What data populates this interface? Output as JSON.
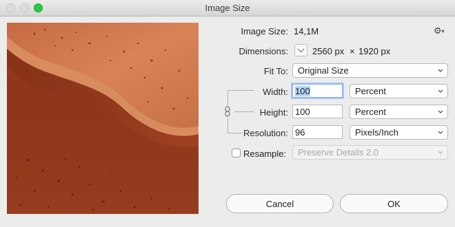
{
  "window": {
    "title": "Image Size"
  },
  "preview": {
    "alt": "Orange desert dunes aerial photo"
  },
  "image_size": {
    "label": "Image Size:",
    "value": "14,1M"
  },
  "dimensions": {
    "label": "Dimensions:",
    "width": "2560 px",
    "times": "×",
    "height": "1920 px"
  },
  "fit_to": {
    "label": "Fit To:",
    "value": "Original Size"
  },
  "width": {
    "label": "Width:",
    "value": "100",
    "unit": "Percent"
  },
  "height": {
    "label": "Height:",
    "value": "100",
    "unit": "Percent"
  },
  "resolution": {
    "label": "Resolution:",
    "value": "96",
    "unit": "Pixels/Inch"
  },
  "resample": {
    "label": "Resample:",
    "value": "Preserve Details 2.0",
    "checked": false
  },
  "buttons": {
    "cancel": "Cancel",
    "ok": "OK"
  },
  "icons": {
    "gear": "gear-icon",
    "chevron": "chevron-down-icon",
    "link": "chain-link-icon"
  }
}
